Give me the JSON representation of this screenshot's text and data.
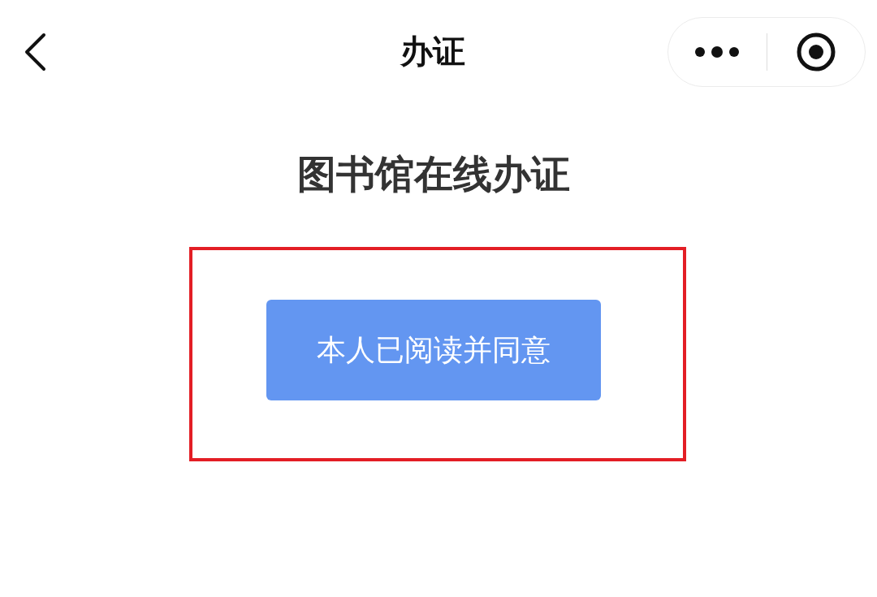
{
  "nav_bar": {
    "title": "办证"
  },
  "heading": "图书馆在线办证",
  "agree_button": {
    "label": "本人已阅读并同意"
  }
}
